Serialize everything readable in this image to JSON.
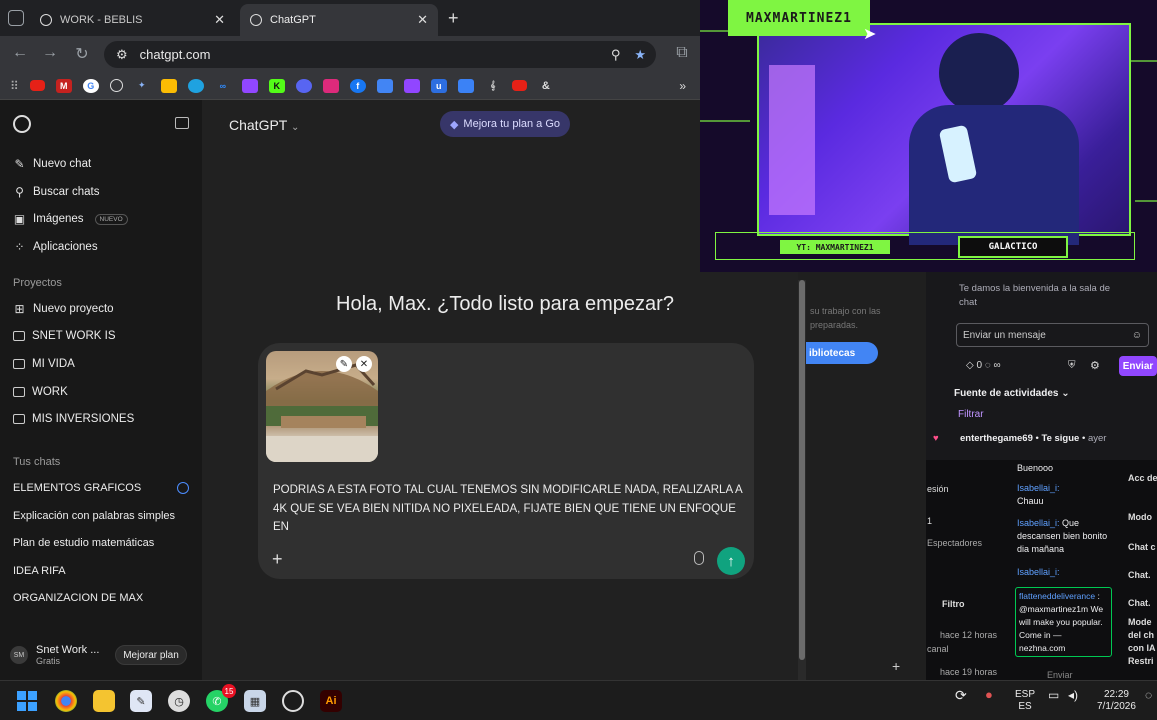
{
  "browser": {
    "tabs": [
      {
        "title": "WORK - BEBLIS"
      },
      {
        "title": "ChatGPT"
      }
    ],
    "url": "chatgpt.com",
    "bookmarks": [
      "youtube",
      "gmail",
      "google",
      "chatgpt",
      "gemini",
      "drive",
      "edge",
      "meta",
      "twitch",
      "kick",
      "discord",
      "instagram",
      "facebook",
      "docs",
      "pinterest",
      "u",
      "figma",
      "kling",
      "youtube-2",
      "&"
    ]
  },
  "sidebar": {
    "items": [
      {
        "label": "Nuevo chat",
        "icon": "edit-icon"
      },
      {
        "label": "Buscar chats",
        "icon": "search-icon"
      },
      {
        "label": "Imágenes",
        "icon": "image-icon",
        "badge": "NUEVO"
      },
      {
        "label": "Aplicaciones",
        "icon": "apps-icon"
      }
    ],
    "projects_title": "Proyectos",
    "projects": [
      "Nuevo proyecto",
      "SNET WORK IS",
      "MI VIDA",
      "WORK",
      "MIS INVERSIONES"
    ],
    "chats_title": "Tus chats",
    "chats": [
      "ELEMENTOS GRAFICOS",
      "Explicación con palabras simples",
      "Plan de estudio matemáticas",
      "IDEA RIFA",
      "ORGANIZACION DE MAX"
    ],
    "user": {
      "initials": "SM",
      "name": "Snet Work ...",
      "plan": "Gratis",
      "upgrade": "Mejorar plan"
    }
  },
  "main": {
    "model": "ChatGPT",
    "upgrade_pill": "Mejora tu plan a Go",
    "greeting": "Hola, Max. ¿Todo listo para empezar?",
    "prompt": "PODRIAS A ESTA FOTO TAL CUAL TENEMOS SIN MODIFICARLE NADA, REALIZARLA A 4K QUE SE VEA BIEN NITIDA NO PIXELEADA, FIJATE BIEN QUE TIENE UN ENFOQUE EN"
  },
  "background": {
    "mid_text": "su trabajo con las preparadas.",
    "library_button": "ibliotecas",
    "twitch": {
      "welcome": "Te damos la bienvenida a la sala de chat",
      "input_placeholder": "Enviar un mensaje",
      "points": "0",
      "send": "Enviar",
      "feed": "Fuente de actividades",
      "filter": "Filtrar",
      "follow_user": "enterthegame69",
      "follow_text": "Te sigue",
      "follow_time": "ayer"
    },
    "dashboard": {
      "col1": [
        "esión",
        "1",
        "Espectadores",
        "Filtro",
        "hace 12 horas",
        "canal",
        "hace 19 horas"
      ],
      "col2": [
        "Acc de",
        "Modo",
        "Chat c",
        "Chat.",
        "Chat.",
        "Mode del ch con IA",
        "Restri"
      ],
      "messages": [
        {
          "user": "",
          "text": "Buenooo"
        },
        {
          "user": "Isabellai_i:",
          "text": "Chauu"
        },
        {
          "user": "Isabellai_i:",
          "text": "Que descansen bien bonito dia mañana"
        },
        {
          "user": "Isabellai_i:",
          "text": ""
        }
      ],
      "spam_user": "flatteneddeliverance",
      "spam_text": ": @maxmartinez1m We will make you popular. Come in — nezhna.com",
      "send": "Enviar"
    }
  },
  "stream": {
    "name": "MAXMARTINEZ1",
    "yt": "YT: MAXMARTINEZ1",
    "tag": "GALACTICO",
    "accent": "#7ff542"
  },
  "taskbar": {
    "apps": [
      "windows",
      "chrome",
      "explorer",
      "notepad",
      "clock",
      "whatsapp",
      "calculator",
      "chatgpt",
      "illustrator"
    ],
    "whatsapp_badge": "15",
    "lang": "ESP",
    "lang_sub": "ES",
    "time": "22:29",
    "date": "7/1/2026"
  }
}
